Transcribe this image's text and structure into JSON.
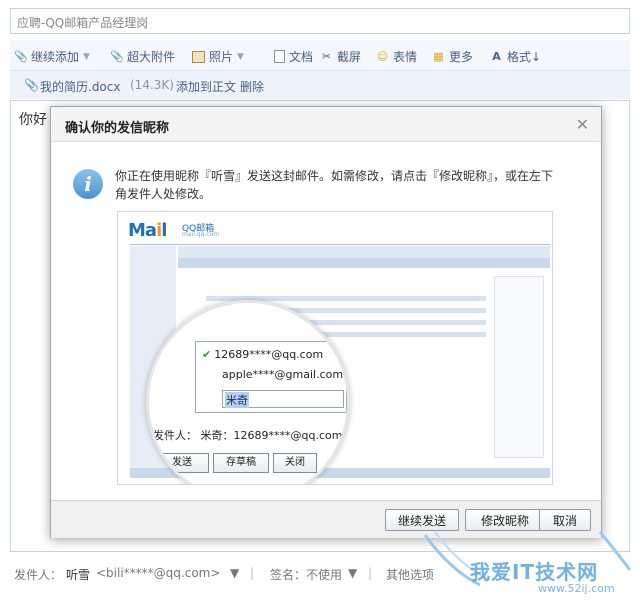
{
  "subject": {
    "value": "应聘-QQ邮箱产品经理岗"
  },
  "toolbar": {
    "continue_add": "继续添加",
    "super_attach": "超大附件",
    "photo": "照片",
    "document": "文档",
    "screenshot": "截屏",
    "emoji": "表情",
    "more": "更多",
    "format": "格式↓"
  },
  "attachment": {
    "filename": "我的简历.docx",
    "size": "(14.3K)",
    "add_to_body": "添加到正文",
    "delete": "删除"
  },
  "editor": {
    "text": "你好"
  },
  "status": {
    "sender_label": "发件人：",
    "sender_name": "听雪",
    "sender_email": "<bili*****@qq.com>",
    "signature": "签名：不使用",
    "other_options": "其他选项"
  },
  "dialog": {
    "title": "确认你的发信昵称",
    "message": "你正在使用昵称『听雪』发送这封邮件。如需修改，请点击『修改昵称』，或在左下角发件人处修改。",
    "illustration": {
      "logo": "Mail",
      "logo_sub": "QQ邮箱",
      "logo_sub2": "mail.qq.com",
      "option1": "12689****@qq.com",
      "option2": "apple****@gmail.com",
      "nickname_input": "米奇",
      "sender_line": "发件人： 米奇：12689****@qq.com",
      "btn_send": "发送",
      "btn_draft": "存草稿",
      "btn_close": "关闭"
    },
    "buttons": {
      "continue_send": "继续发送",
      "modify_nickname": "修改昵称",
      "cancel": "取消"
    }
  },
  "watermark": {
    "text": "我爱IT技术网",
    "url": "www.52ij.com"
  }
}
